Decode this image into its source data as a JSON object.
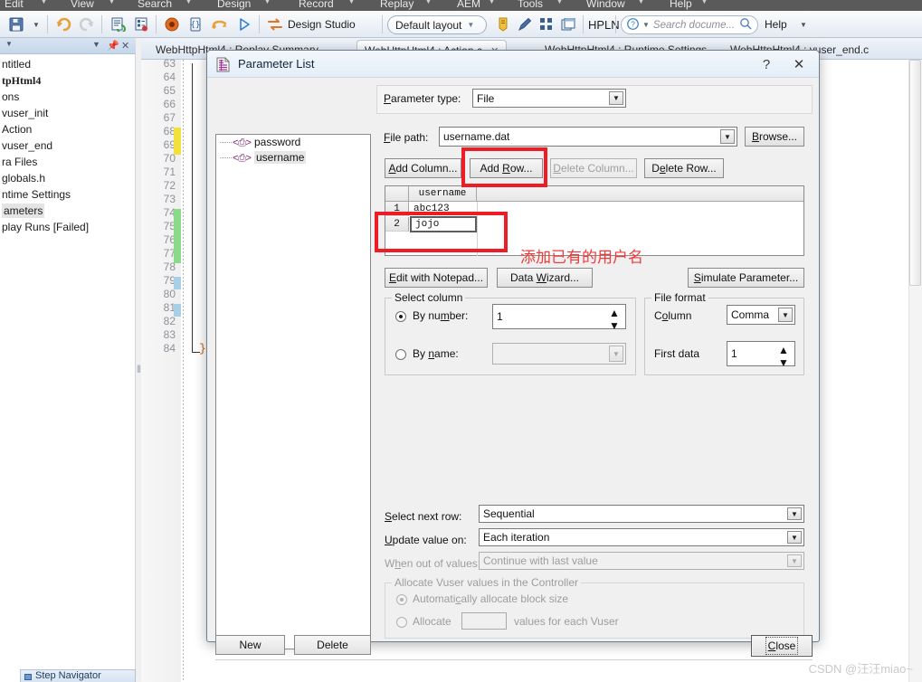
{
  "app": {
    "menu": [
      {
        "label": "Edit"
      },
      {
        "label": "View"
      },
      {
        "label": "Search"
      },
      {
        "label": "Design"
      },
      {
        "label": "Record"
      },
      {
        "label": "Replay"
      },
      {
        "label": "AEM"
      },
      {
        "label": "Tools"
      },
      {
        "label": "Window"
      },
      {
        "label": "Help"
      }
    ],
    "toolbar": {
      "design_studio_label": "Design Studio",
      "layout_label": "Default layout",
      "hpln_label": "HPLN",
      "search_placeholder": "Search docume...",
      "help_label": "Help"
    }
  },
  "left_panel": {
    "tree": [
      {
        "label": "ntitled",
        "bold": false,
        "selected": false
      },
      {
        "label": "tpHtml4",
        "bold": true,
        "selected": false
      },
      {
        "label": "ons",
        "bold": false,
        "selected": false
      },
      {
        "label": "vuser_init",
        "bold": false,
        "selected": false
      },
      {
        "label": "Action",
        "bold": false,
        "selected": false
      },
      {
        "label": "vuser_end",
        "bold": false,
        "selected": false
      },
      {
        "label": "ra Files",
        "bold": false,
        "selected": false
      },
      {
        "label": "globals.h",
        "bold": false,
        "selected": false
      },
      {
        "label": "ntime Settings",
        "bold": false,
        "selected": false
      },
      {
        "label": "ameters",
        "bold": false,
        "selected": true
      },
      {
        "label": "play Runs [Failed]",
        "bold": false,
        "selected": false
      }
    ],
    "step_navigator_label": "Step Navigator"
  },
  "editor": {
    "tabs": [
      {
        "label": "WebHttpHtml4 : Replay Summary",
        "active": false,
        "closable": false
      },
      {
        "label": "WebHttpHtml4 : Action.c",
        "active": true,
        "closable": true
      },
      {
        "label": "WebHttpHtml4 : Runtime Settings",
        "active": false,
        "closable": false
      },
      {
        "label": "WebHttpHtml4 : vuser_end.c",
        "active": false,
        "closable": false
      }
    ],
    "line_numbers": [
      63,
      64,
      65,
      66,
      67,
      68,
      69,
      70,
      71,
      72,
      73,
      74,
      75,
      76,
      77,
      78,
      79,
      80,
      81,
      82,
      83,
      84
    ],
    "closing_brace": "}",
    "markers": [
      {
        "from": 68,
        "to": 69,
        "color": "#f2e13c"
      },
      {
        "from": 74,
        "to": 77,
        "color": "#8ada8a"
      },
      {
        "from": 79,
        "to": 79,
        "color": "#a9cfe4"
      },
      {
        "from": 81,
        "to": 81,
        "color": "#a9cfe4"
      }
    ]
  },
  "dialog": {
    "title": "Parameter List",
    "help_button": "?",
    "close_button": "✕",
    "parameter_tree": [
      {
        "label": "password",
        "selected": false
      },
      {
        "label": "username",
        "selected": true
      }
    ],
    "parameter_type": {
      "label": "Parameter type:",
      "value": "File"
    },
    "file_path": {
      "label": "File path:",
      "value": "username.dat"
    },
    "browse_button": "Browse...",
    "row_buttons": [
      {
        "label": "Add Column...",
        "disabled": false
      },
      {
        "label": "Add Row...",
        "disabled": false
      },
      {
        "label": "Delete Column...",
        "disabled": true
      },
      {
        "label": "Delete Row...",
        "disabled": false
      }
    ],
    "grid": {
      "columns": [
        "username"
      ],
      "rows": [
        {
          "num": "1",
          "values": [
            "abc123"
          ],
          "editing": false
        },
        {
          "num": "2",
          "values": [
            "jojo"
          ],
          "editing": true
        }
      ]
    },
    "tool_buttons": [
      {
        "label": "Edit with Notepad..."
      },
      {
        "label": "Data Wizard..."
      },
      {
        "label": "Simulate Parameter..."
      }
    ],
    "select_column": {
      "group_label": "Select column",
      "by_number_label": "By number:",
      "by_number_selected": true,
      "by_number_value": "1",
      "by_name_label": "By name:",
      "by_name_selected": false,
      "by_name_value": ""
    },
    "file_format": {
      "group_label": "File format",
      "column_label": "Column",
      "column_value": "Comma",
      "first_data_label": "First data",
      "first_data_value": "1"
    },
    "select_next_row": {
      "label": "Select next row:",
      "value": "Sequential"
    },
    "update_value_on": {
      "label": "Update value on:",
      "value": "Each iteration"
    },
    "when_out_of_values": {
      "label": "When out of values:",
      "value": "Continue with last value",
      "disabled": true
    },
    "allocate_group": {
      "group_label": "Allocate Vuser values in the Controller",
      "auto_label": "Automatically allocate block size",
      "auto_selected": true,
      "allocate_label": "Allocate",
      "allocate_value": "",
      "allocate_suffix": "values for each Vuser",
      "disabled": true
    },
    "new_button": "New",
    "delete_button": "Delete",
    "close_bottom_button": "Close"
  },
  "annotations": {
    "note_text": "添加已有的用户名",
    "highlight_color": "#ee1c24"
  },
  "watermark": "CSDN @汪汪miao~"
}
